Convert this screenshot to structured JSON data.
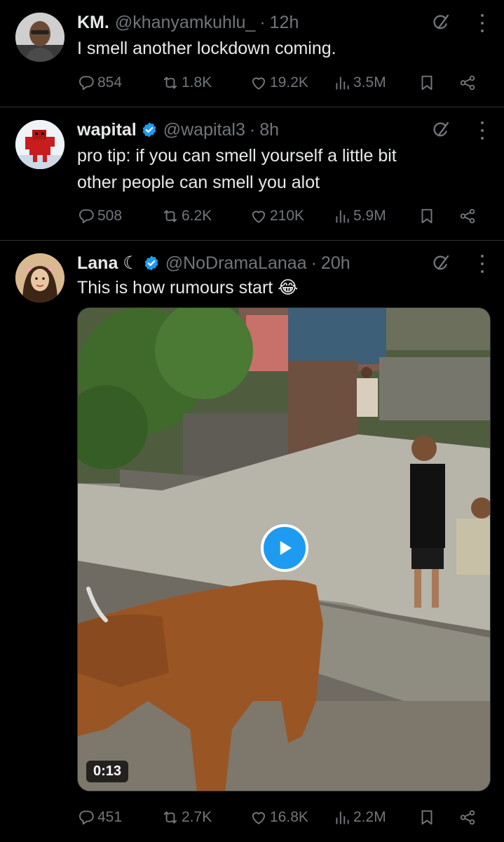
{
  "tweets": [
    {
      "name": "KM.",
      "handle": "@khanyamkuhlu_",
      "time": "12h",
      "verified": false,
      "text": "I smell another lockdown coming.",
      "replies": "854",
      "retweets": "1.8K",
      "likes": "19.2K",
      "views": "3.5M"
    },
    {
      "name": "wapital",
      "handle": "@wapital3",
      "time": "8h",
      "verified": true,
      "text_lines": [
        "pro tip: if you can smell yourself a little bit",
        "other people can smell you alot"
      ],
      "replies": "508",
      "retweets": "6.2K",
      "likes": "210K",
      "views": "5.9M"
    },
    {
      "name": "Lana ☾",
      "handle": "@NoDramaLanaa",
      "time": "20h",
      "verified": true,
      "text": "This is how rumours start 😂",
      "video_duration": "0:13",
      "replies": "451",
      "retweets": "2.7K",
      "likes": "16.8K",
      "views": "2.2M"
    }
  ],
  "separator": "·",
  "colors": {
    "background": "#000000",
    "text": "#e7e9ea",
    "secondary": "#71767b",
    "accent": "#1d9bf0",
    "divider": "#2f3336"
  },
  "icons": [
    "reply-icon",
    "retweet-icon",
    "like-icon",
    "views-icon",
    "bookmark-icon",
    "share-icon",
    "grok-icon",
    "more-icon",
    "verified-icon",
    "play-icon"
  ]
}
